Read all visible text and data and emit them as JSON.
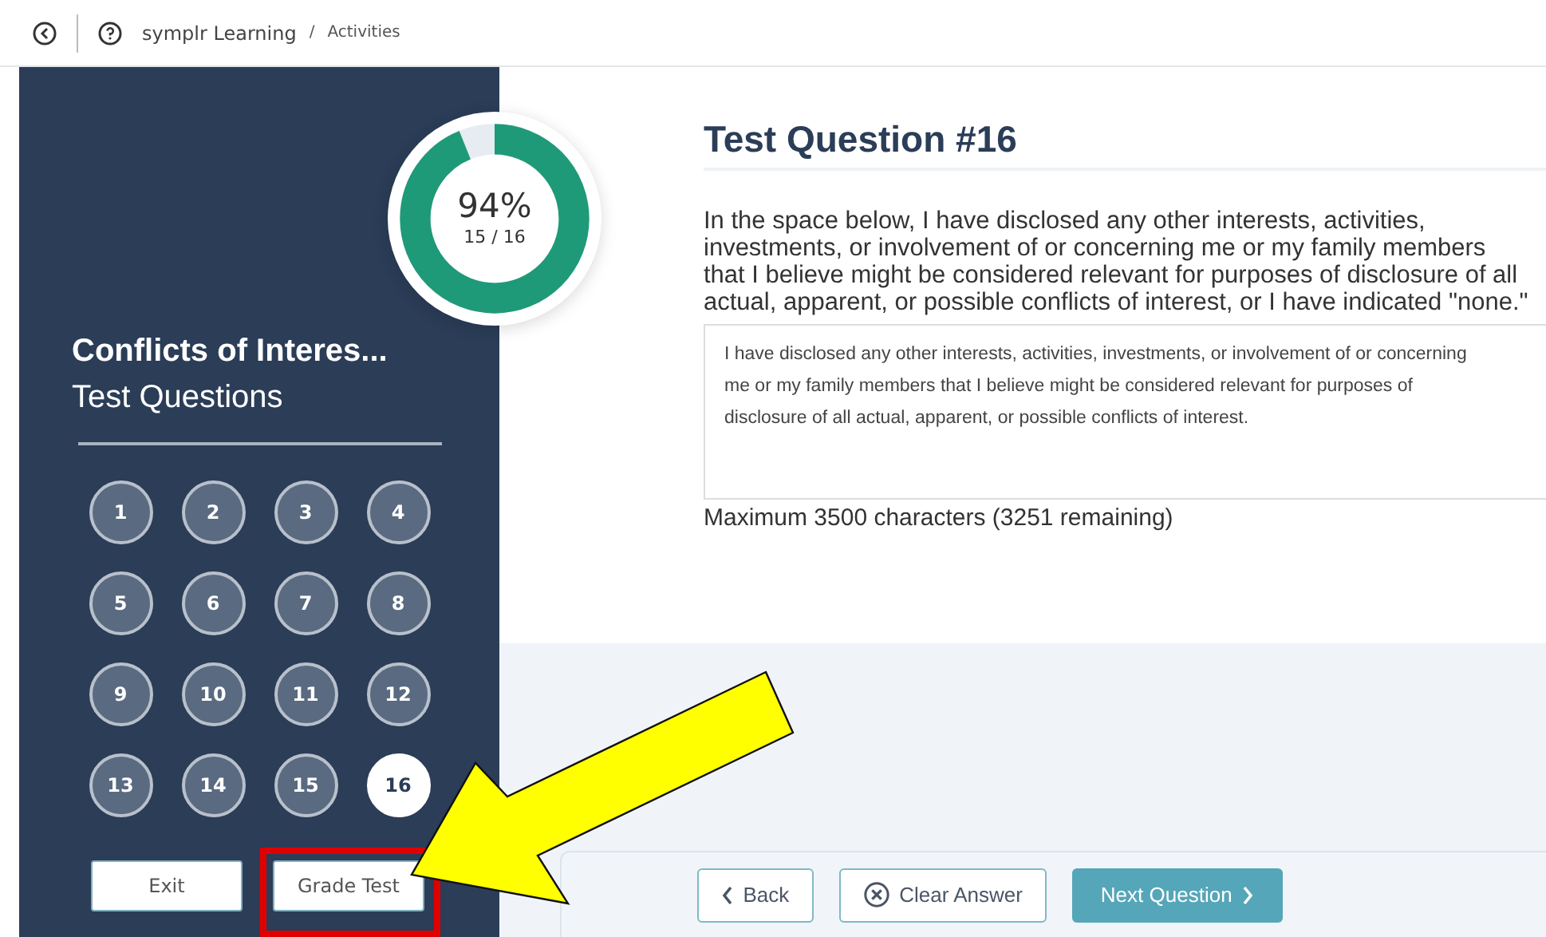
{
  "breadcrumb": {
    "app": "symplr Learning",
    "separator": "/",
    "page": "Activities"
  },
  "progress": {
    "percent": "94%",
    "count": "15 / 16",
    "level": 0.9375
  },
  "sidebar": {
    "title": "Conflicts of Interes...",
    "subtitle": "Test Questions",
    "questions": [
      {
        "label": "1",
        "selected": false
      },
      {
        "label": "2",
        "selected": false
      },
      {
        "label": "3",
        "selected": false
      },
      {
        "label": "4",
        "selected": false
      },
      {
        "label": "5",
        "selected": false
      },
      {
        "label": "6",
        "selected": false
      },
      {
        "label": "7",
        "selected": false
      },
      {
        "label": "8",
        "selected": false
      },
      {
        "label": "9",
        "selected": false
      },
      {
        "label": "10",
        "selected": false
      },
      {
        "label": "11",
        "selected": false
      },
      {
        "label": "12",
        "selected": false
      },
      {
        "label": "13",
        "selected": false
      },
      {
        "label": "14",
        "selected": false
      },
      {
        "label": "15",
        "selected": false
      },
      {
        "label": "16",
        "selected": true
      }
    ],
    "buttons": [
      {
        "label": "Exit",
        "highlighted": false
      },
      {
        "label": "Grade Test",
        "highlighted": true
      }
    ]
  },
  "question": {
    "title": "Test Question #16",
    "prompt": "In the space below, I have disclosed any other interests, activities, investments, or involvement of or concerning me or my family members that I believe might be considered relevant for purposes of disclosure of all actual, apparent, or possible conflicts of interest, or I have indicated \"none.\"",
    "answer": "I have disclosed any other interests, activities, investments, or involvement of or concerning me or my family members that I believe might be considered relevant for purposes of disclosure of all actual, apparent, or possible conflicts of interest.",
    "limit": "Maximum 3500 characters (3251 remaining)"
  },
  "footer": {
    "buttons": [
      {
        "label": "Back",
        "kind": "back"
      },
      {
        "label": "Clear Answer",
        "kind": "clear"
      },
      {
        "label": "Next Question",
        "kind": "next"
      }
    ]
  },
  "annotation": {
    "arrow": true
  }
}
